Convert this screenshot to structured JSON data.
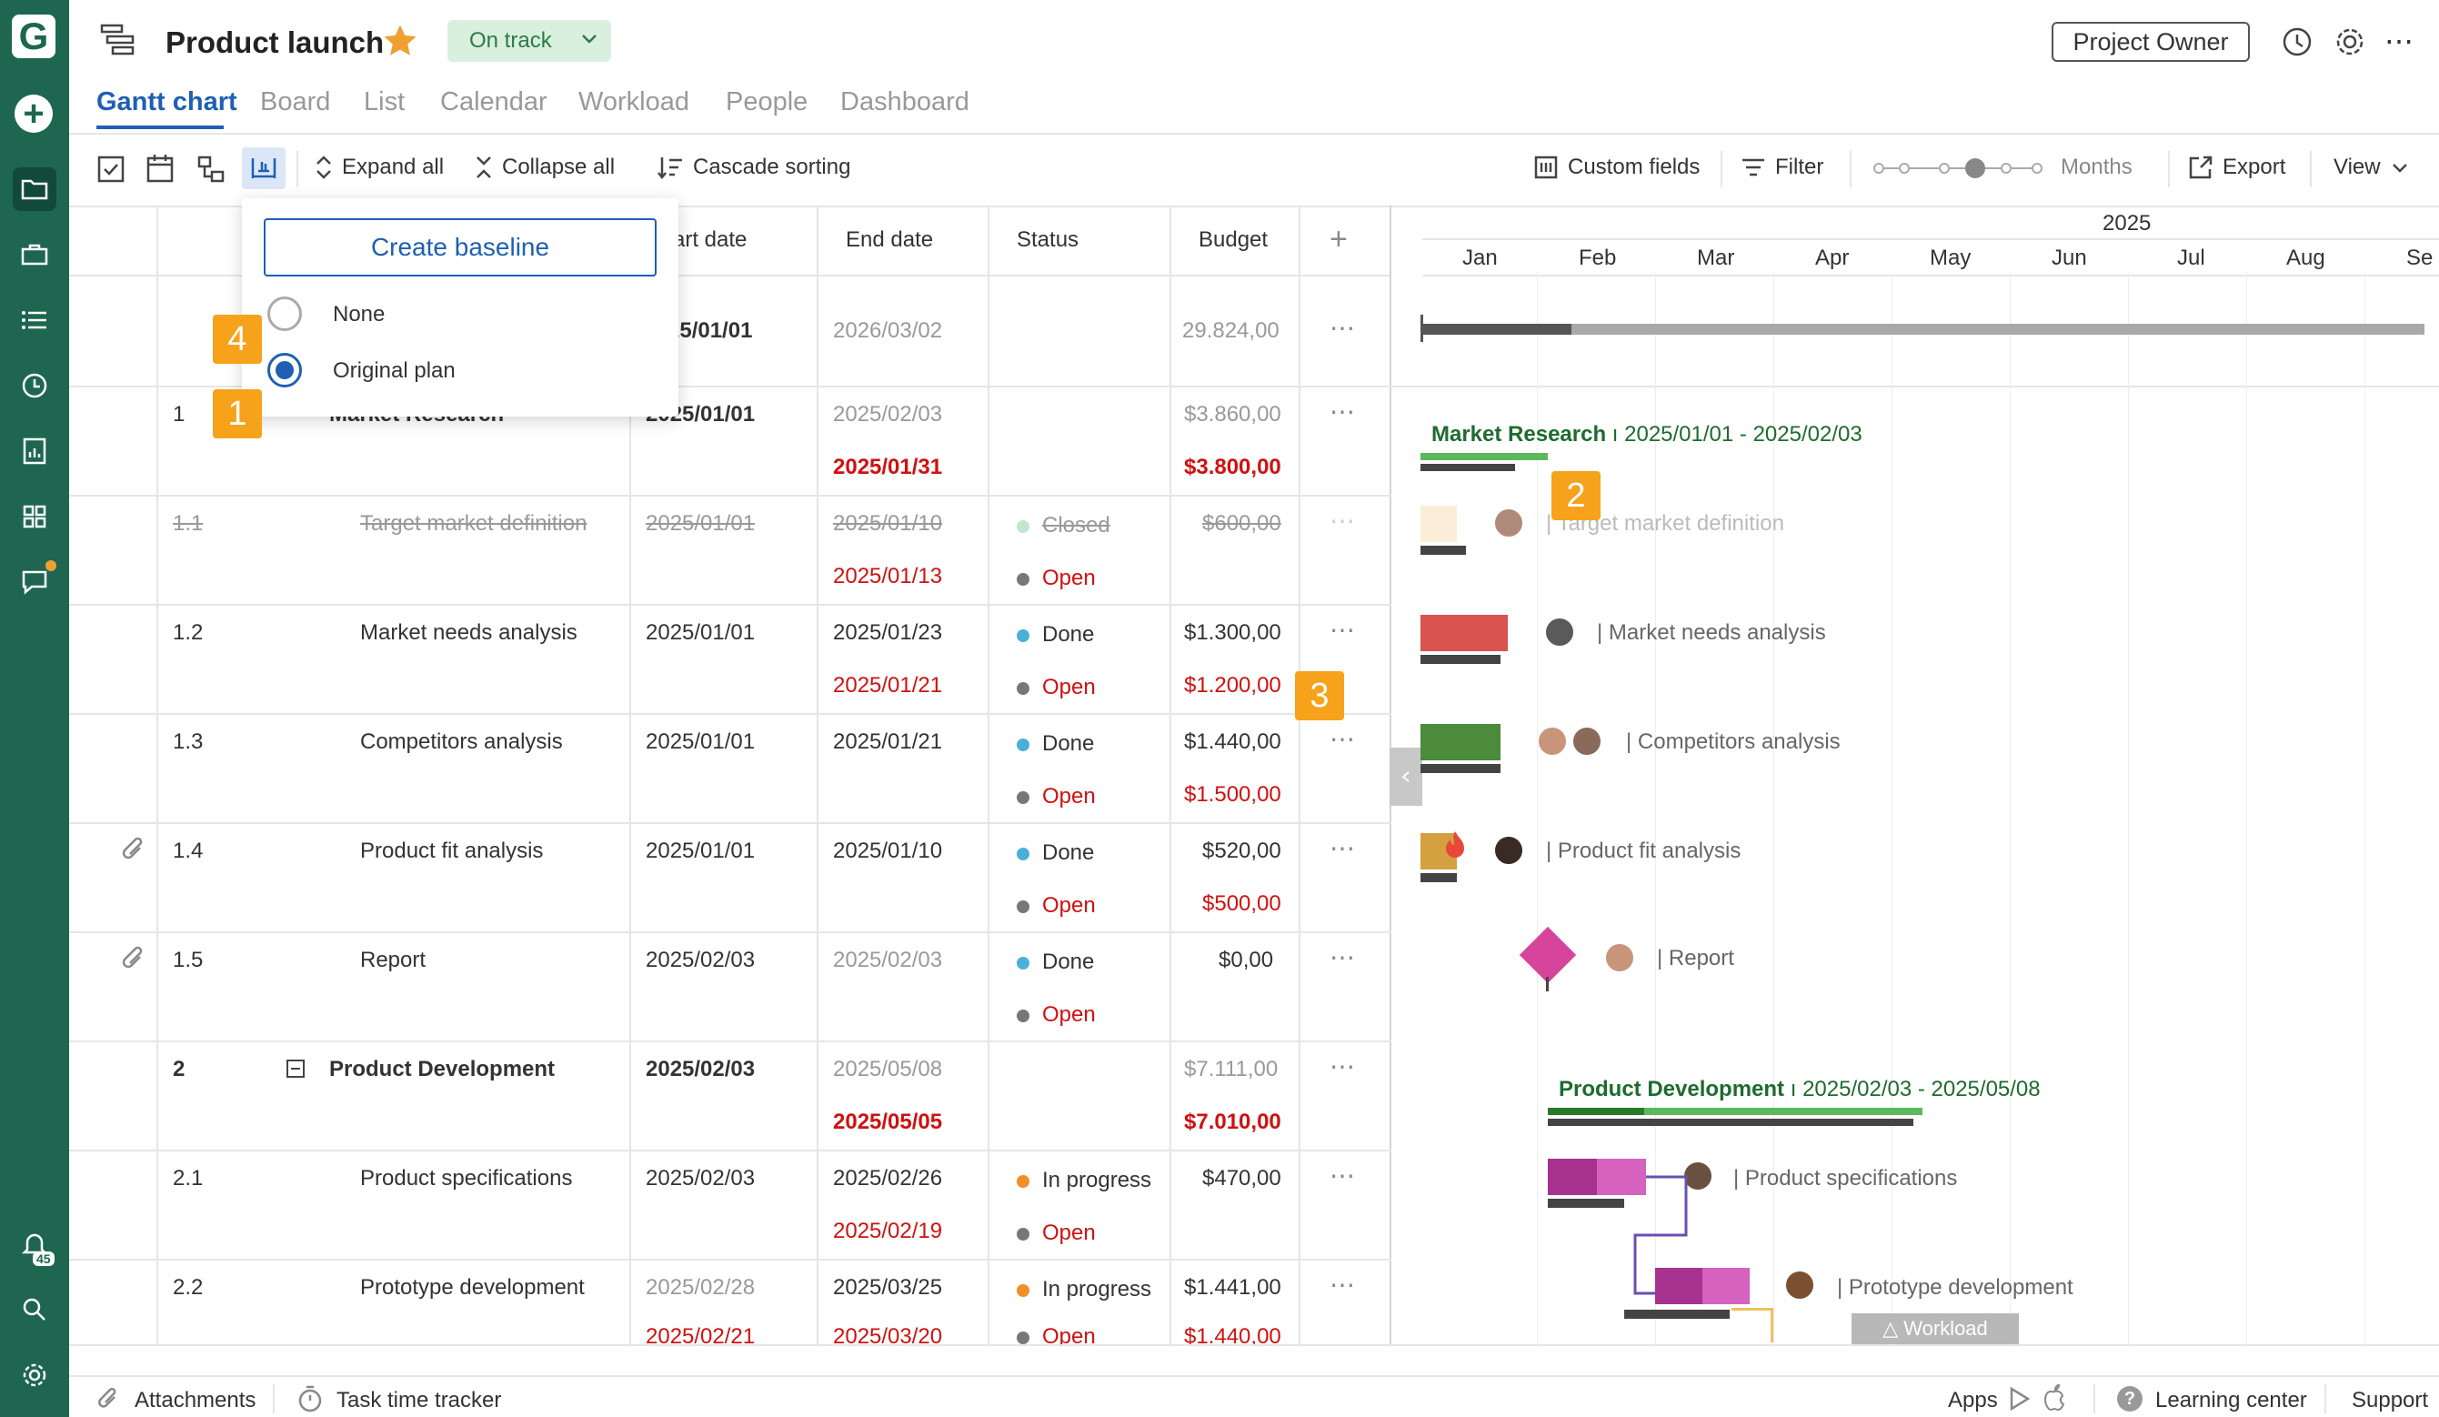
{
  "header": {
    "title": "Product launch",
    "status": "On track",
    "owner_button": "Project Owner"
  },
  "tabs": [
    "Gantt chart",
    "Board",
    "List",
    "Calendar",
    "Workload",
    "People",
    "Dashboard"
  ],
  "toolbar": {
    "expand_all": "Expand all",
    "collapse_all": "Collapse all",
    "cascade_sorting": "Cascade sorting",
    "custom_fields": "Custom fields",
    "filter": "Filter",
    "zoom_label": "Months",
    "export": "Export",
    "view": "View"
  },
  "baseline_popup": {
    "create_button": "Create baseline",
    "options": [
      {
        "label": "None",
        "selected": false
      },
      {
        "label": "Original plan",
        "selected": true
      }
    ]
  },
  "columns": {
    "start_date_partial": "art date",
    "end_date": "End date",
    "status": "Status",
    "budget": "Budget"
  },
  "project_row": {
    "start": "25/01/01",
    "end": "2026/03/02",
    "budget": "29.824,00"
  },
  "rows": [
    {
      "id": "1",
      "name": "Market Research",
      "start": "2025/01/01",
      "end": "2025/02/03",
      "end_baseline": "2025/01/31",
      "status": "",
      "status_baseline": "",
      "budget": "$3.860,00",
      "budget_baseline": "$3.800,00"
    },
    {
      "id": "1.1",
      "name": "Target market definition",
      "start": "2025/01/01",
      "end": "2025/01/10",
      "end_baseline": "2025/01/13",
      "status": "Closed",
      "status_baseline": "Open",
      "budget": "$600,00",
      "budget_baseline": ""
    },
    {
      "id": "1.2",
      "name": "Market needs analysis",
      "start": "2025/01/01",
      "end": "2025/01/23",
      "end_baseline": "2025/01/21",
      "status": "Done",
      "status_baseline": "Open",
      "budget": "$1.300,00",
      "budget_baseline": "$1.200,00"
    },
    {
      "id": "1.3",
      "name": "Competitors analysis",
      "start": "2025/01/01",
      "end": "2025/01/21",
      "end_baseline": "",
      "status": "Done",
      "status_baseline": "Open",
      "budget": "$1.440,00",
      "budget_baseline": "$1.500,00"
    },
    {
      "id": "1.4",
      "name": "Product fit analysis",
      "start": "2025/01/01",
      "end": "2025/01/10",
      "end_baseline": "",
      "status": "Done",
      "status_baseline": "Open",
      "budget": "$520,00",
      "budget_baseline": "$500,00"
    },
    {
      "id": "1.5",
      "name": "Report",
      "start": "2025/02/03",
      "end": "2025/02/03",
      "end_baseline": "",
      "status": "Done",
      "status_baseline": "Open",
      "budget": "$0,00",
      "budget_baseline": ""
    },
    {
      "id": "2",
      "name": "Product Development",
      "start": "2025/02/03",
      "end": "2025/05/08",
      "end_baseline": "2025/05/05",
      "status": "",
      "status_baseline": "",
      "budget": "$7.111,00",
      "budget_baseline": "$7.010,00"
    },
    {
      "id": "2.1",
      "name": "Product specifications",
      "start": "2025/02/03",
      "end": "2025/02/26",
      "end_baseline": "2025/02/19",
      "status": "In progress",
      "status_baseline": "Open",
      "budget": "$470,00",
      "budget_baseline": ""
    },
    {
      "id": "2.2",
      "name": "Prototype development",
      "start": "2025/02/28",
      "end": "2025/03/25",
      "end_baseline": "2025/03/20",
      "start_baseline": "2025/02/21",
      "status": "In progress",
      "status_baseline": "Open",
      "budget": "$1.441,00",
      "budget_baseline": "$1.440,00"
    }
  ],
  "gantt": {
    "year": "2025",
    "months": [
      "Jan",
      "Feb",
      "Mar",
      "Apr",
      "May",
      "Jun",
      "Jul",
      "Aug",
      "Se"
    ],
    "summary1": {
      "name": "Market Research",
      "range": "2025/01/01 - 2025/02/03"
    },
    "summary2": {
      "name": "Product Development",
      "range": "2025/02/03 - 2025/05/08"
    },
    "labels": [
      "Target market definition",
      "Market needs analysis",
      "Competitors analysis",
      "Product fit analysis",
      "Report",
      "Product specifications",
      "Prototype development"
    ],
    "workload_tab": "Workload"
  },
  "badges": [
    "1",
    "2",
    "3",
    "4"
  ],
  "footer": {
    "attachments": "Attachments",
    "time_tracker": "Task time tracker",
    "apps": "Apps",
    "learning": "Learning center",
    "support": "Support"
  },
  "notifications_count": "45",
  "colors": {
    "sidebar": "#1e6650",
    "accent": "#1e5fb4",
    "badge": "#f7a21b",
    "overdue": "#d01010"
  }
}
